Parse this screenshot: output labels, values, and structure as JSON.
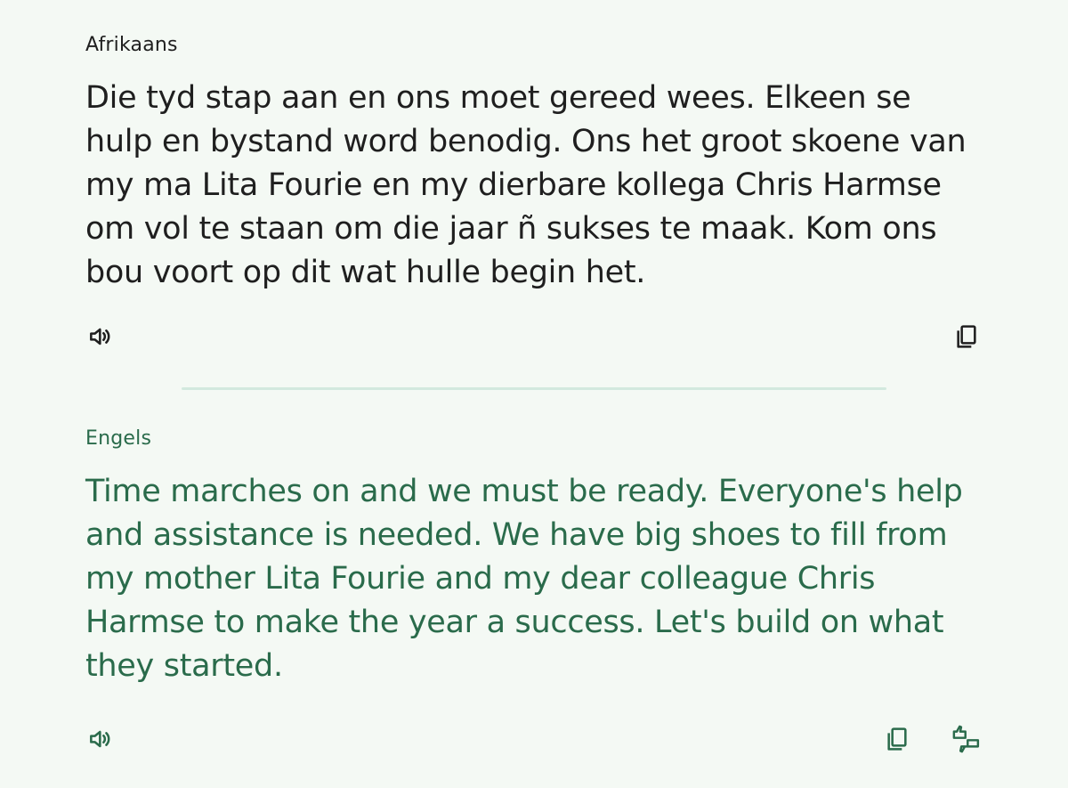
{
  "source": {
    "language": "Afrikaans",
    "text": "Die tyd stap aan en ons moet gereed wees. Elkeen se hulp en bystand word benodig. Ons het groot skoene van my ma Lita Fourie en my dierbare kollega Chris Harmse om vol te staan om die jaar ñ sukses te maak. Kom ons bou voort op dit wat hulle begin het.",
    "icons": {
      "listen": "speaker-icon",
      "copy": "copy-icon"
    }
  },
  "target": {
    "language": "Engels",
    "text": "Time marches on and we must be ready.  Everyone's help and assistance is needed.  We have big shoes to fill from my mother Lita Fourie and my dear colleague Chris Harmse to make the year a success.  Let's build on what they started.",
    "icons": {
      "listen": "speaker-icon",
      "copy": "copy-icon",
      "feedback": "thumbs-feedback-icon"
    }
  },
  "colors": {
    "background": "#f4f9f4",
    "source_text": "#1f1f1f",
    "target_text": "#2a6b4b",
    "divider": "#d2e9de"
  }
}
